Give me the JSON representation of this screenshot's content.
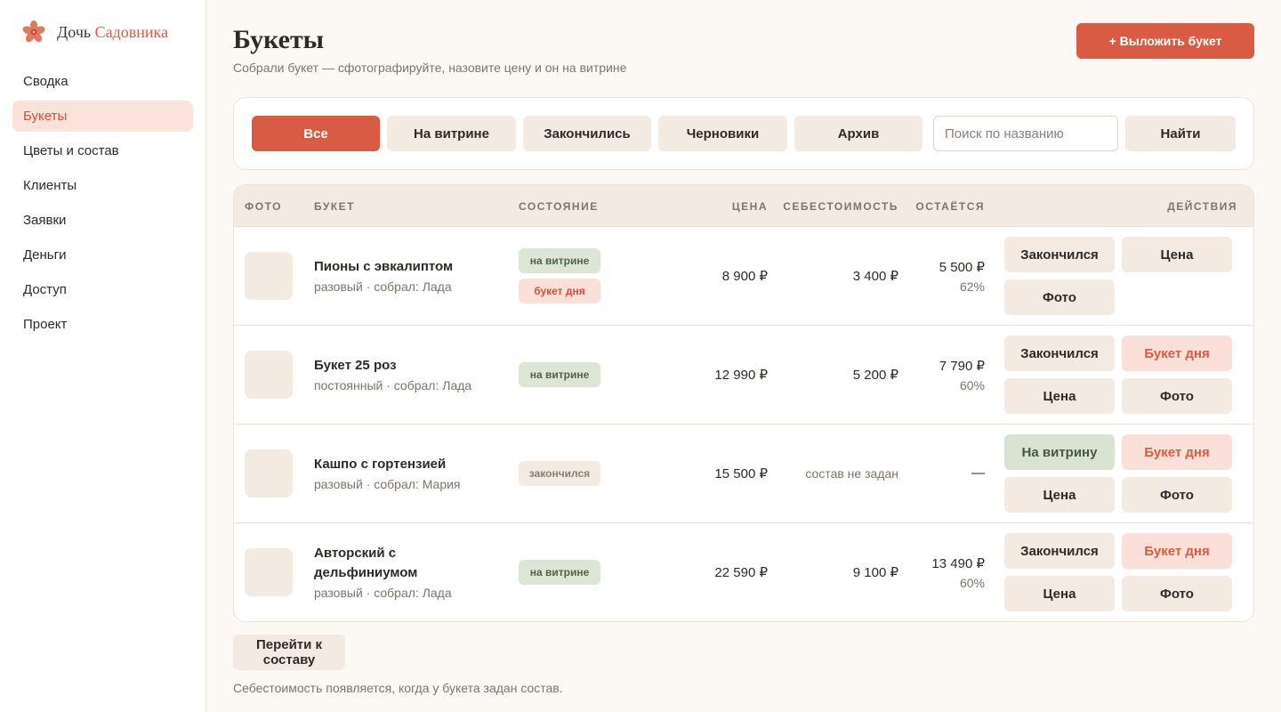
{
  "brand": {
    "name_part1": "Дочь",
    "name_part2": "Садовника",
    "icon": "flower-icon",
    "accent_color": "#d95b43"
  },
  "sidebar": {
    "items": [
      {
        "label": "Сводка",
        "active": false
      },
      {
        "label": "Букеты",
        "active": true
      },
      {
        "label": "Цветы и состав",
        "active": false
      },
      {
        "label": "Клиенты",
        "active": false
      },
      {
        "label": "Заявки",
        "active": false
      },
      {
        "label": "Деньги",
        "active": false
      },
      {
        "label": "Доступ",
        "active": false
      },
      {
        "label": "Проект",
        "active": false
      }
    ]
  },
  "header": {
    "title": "Букеты",
    "subtitle": "Собрали букет — сфотографируйте, назовите цену и он на витрине",
    "primary_button": "+ Выложить букет"
  },
  "filters": {
    "tabs": [
      {
        "label": "Все",
        "active": true
      },
      {
        "label": "На витрине",
        "active": false
      },
      {
        "label": "Закончились",
        "active": false
      },
      {
        "label": "Черновики",
        "active": false
      },
      {
        "label": "Архив",
        "active": false
      }
    ],
    "search_placeholder": "Поиск по названию",
    "search_value": "",
    "search_button": "Найти"
  },
  "table": {
    "columns": [
      "ФОТО",
      "БУКЕТ",
      "СОСТОЯНИЕ",
      "ЦЕНА",
      "СЕБЕСТОИМОСТЬ",
      "ОСТАЁТСЯ",
      "ДЕЙСТВИЯ"
    ],
    "rows": [
      {
        "name": "Пионы с эвкалиптом",
        "meta": "разовый · собрал: Лада",
        "badges": [
          {
            "label": "на витрине",
            "style": "green"
          },
          {
            "label": "букет дня",
            "style": "pink"
          }
        ],
        "price": "8 900 ₽",
        "cost": "3 400 ₽",
        "remain": "5 500 ₽",
        "remain_pct": "62%",
        "actions": [
          {
            "label": "Закончился",
            "style": "beige"
          },
          {
            "label": "Цена",
            "style": "beige"
          },
          {
            "label": "Фото",
            "style": "beige"
          }
        ]
      },
      {
        "name": "Букет 25 роз",
        "meta": "постоянный · собрал: Лада",
        "badges": [
          {
            "label": "на витрине",
            "style": "green"
          }
        ],
        "price": "12 990 ₽",
        "cost": "5 200 ₽",
        "remain": "7 790 ₽",
        "remain_pct": "60%",
        "actions": [
          {
            "label": "Закончился",
            "style": "beige"
          },
          {
            "label": "Букет дня",
            "style": "pink"
          },
          {
            "label": "Цена",
            "style": "beige"
          },
          {
            "label": "Фото",
            "style": "beige"
          }
        ]
      },
      {
        "name": "Кашпо с гортензией",
        "meta": "разовый · собрал: Мария",
        "badges": [
          {
            "label": "закончился",
            "style": "beige"
          }
        ],
        "price": "15 500 ₽",
        "cost": "состав не задан",
        "remain": "—",
        "remain_pct": "",
        "actions": [
          {
            "label": "На витрину",
            "style": "green"
          },
          {
            "label": "Букет дня",
            "style": "pink"
          },
          {
            "label": "Цена",
            "style": "beige"
          },
          {
            "label": "Фото",
            "style": "beige"
          }
        ]
      },
      {
        "name": "Авторский с дельфиниумом",
        "meta": "разовый · собрал: Лада",
        "badges": [
          {
            "label": "на витрине",
            "style": "green"
          }
        ],
        "price": "22 590 ₽",
        "cost": "9 100 ₽",
        "remain": "13 490 ₽",
        "remain_pct": "60%",
        "actions": [
          {
            "label": "Закончился",
            "style": "beige"
          },
          {
            "label": "Букет дня",
            "style": "pink"
          },
          {
            "label": "Цена",
            "style": "beige"
          },
          {
            "label": "Фото",
            "style": "beige"
          }
        ]
      }
    ]
  },
  "compose_button": "Перейти к составу",
  "footer_note": "Себестоимость появляется, когда у букета задан состав."
}
